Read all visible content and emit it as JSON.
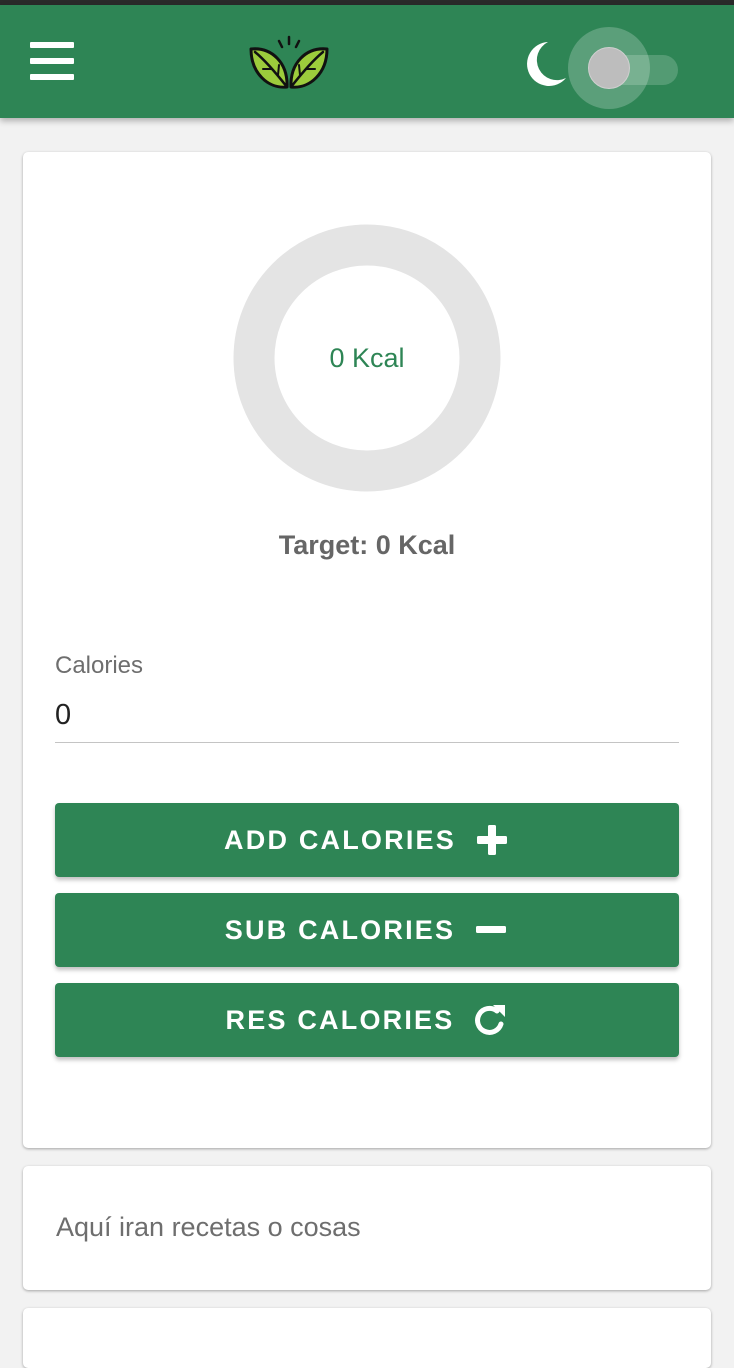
{
  "appbar": {
    "menu_icon": "hamburger-menu-icon",
    "logo_icon": "leaf-logo-icon",
    "theme_icon": "moon-icon",
    "dark_mode_enabled": false,
    "color": "#2e8555"
  },
  "tracker": {
    "consumed_label": "0 Kcal",
    "target_label": "Target: 0 Kcal",
    "progress": 0,
    "ring_color": "#e4e4e4",
    "calories_field": {
      "label": "Calories",
      "value": "0"
    },
    "buttons": {
      "add_label": "ADD CALORIES",
      "add_icon": "plus-icon",
      "sub_label": "SUB CALORIES",
      "sub_icon": "minus-icon",
      "res_label": "RES CALORIES",
      "res_icon": "refresh-icon"
    }
  },
  "recipes": {
    "placeholder_text": "Aquí iran recetas o cosas"
  }
}
